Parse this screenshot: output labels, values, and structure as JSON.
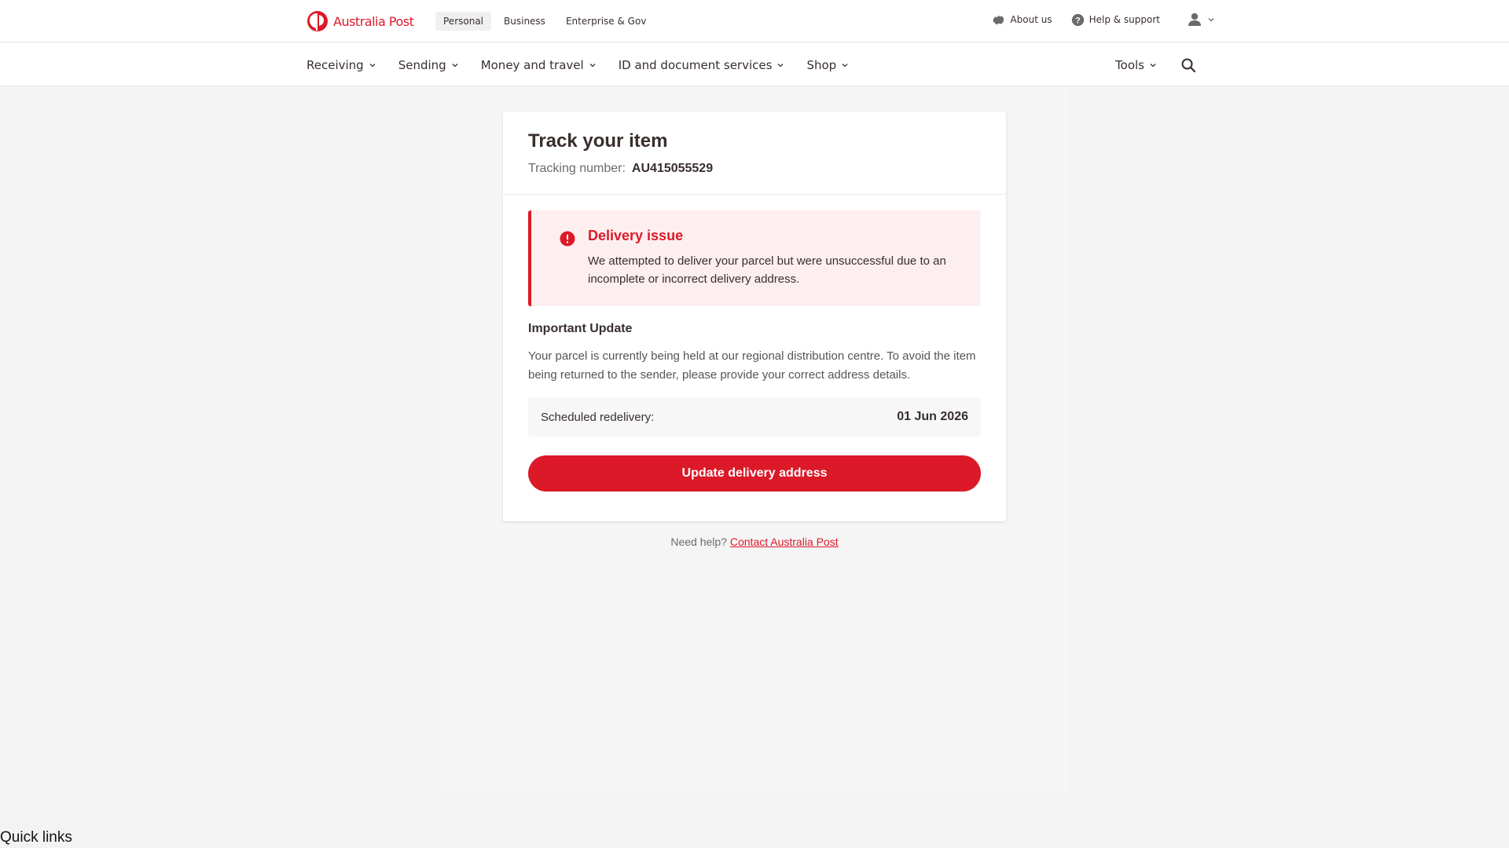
{
  "brand": {
    "name": "Australia Post",
    "color": "#dc1928"
  },
  "segments": [
    {
      "label": "Personal",
      "active": true
    },
    {
      "label": "Business",
      "active": false
    },
    {
      "label": "Enterprise & Gov",
      "active": false
    }
  ],
  "utility": {
    "about_label": "About us",
    "about_icon": "australia-map-icon",
    "help_label": "Help & support",
    "help_icon": "question-circle-icon",
    "account_icon": "user-icon"
  },
  "nav": {
    "items": [
      {
        "label": "Receiving"
      },
      {
        "label": "Sending"
      },
      {
        "label": "Money and travel"
      },
      {
        "label": "ID and document services"
      },
      {
        "label": "Shop"
      }
    ],
    "tools_label": "Tools",
    "search_icon": "search-icon"
  },
  "card": {
    "title": "Track your item",
    "tracking_label": "Tracking number:",
    "tracking_number": "AU415055529",
    "alert": {
      "icon": "exclamation-circle-icon",
      "title": "Delivery issue",
      "text": "We attempted to deliver your parcel but were unsuccessful due to an incomplete or incorrect delivery address."
    },
    "update_heading": "Important Update",
    "update_text": "Your parcel is currently being held at our regional distribution centre. To avoid the item being returned to the sender, please provide your correct address details.",
    "redelivery_label": "Scheduled redelivery:",
    "redelivery_date": "01 Jun 2026",
    "cta_label": "Update delivery address"
  },
  "help": {
    "prefix": "Need help?",
    "link_label": "Contact Australia Post"
  },
  "footer": {
    "quick_links_label": "Quick links"
  }
}
